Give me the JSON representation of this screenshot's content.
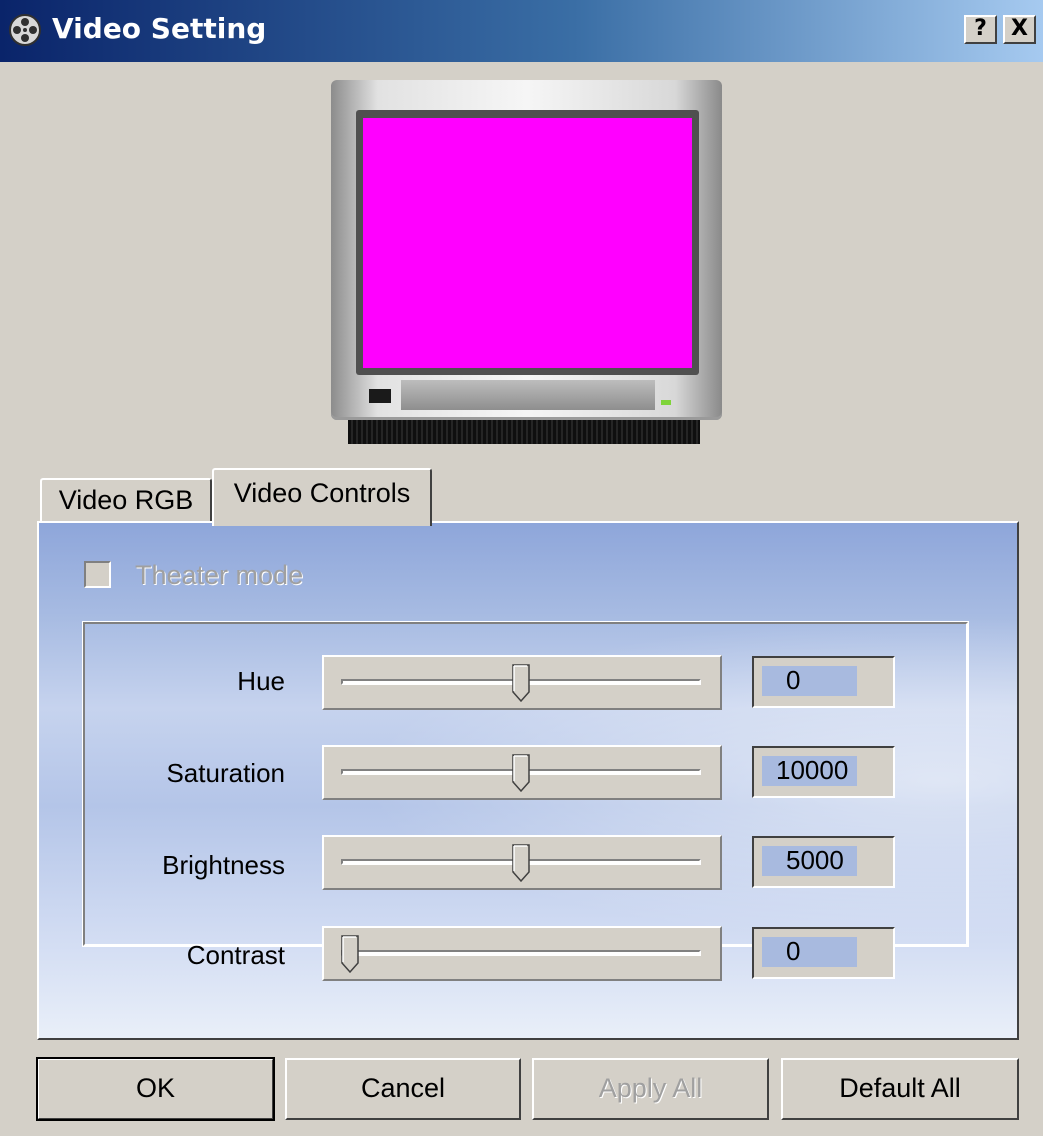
{
  "window": {
    "title": "Video Setting",
    "help_label": "?",
    "close_label": "X"
  },
  "preview": {
    "screen_color": "#ff00ff"
  },
  "tabs": [
    {
      "label": "Video RGB",
      "active": false
    },
    {
      "label": "Video Controls",
      "active": true
    }
  ],
  "theater_mode": {
    "label": "Theater mode",
    "checked": false,
    "enabled": false
  },
  "controls": [
    {
      "label": "Hue",
      "value": "0",
      "slider_fraction": 0.5
    },
    {
      "label": "Saturation",
      "value": "10000",
      "slider_fraction": 0.5
    },
    {
      "label": "Brightness",
      "value": "5000",
      "slider_fraction": 0.5
    },
    {
      "label": "Contrast",
      "value": "0",
      "slider_fraction": 0.0
    }
  ],
  "buttons": {
    "ok": "OK",
    "cancel": "Cancel",
    "apply_all": "Apply All",
    "default_all": "Default All"
  },
  "colors": {
    "titlebar_start": "#0a246a",
    "titlebar_end": "#a6caf0",
    "panel_accent": "#a7bbe2",
    "dialog_face": "#d4d0c8"
  }
}
